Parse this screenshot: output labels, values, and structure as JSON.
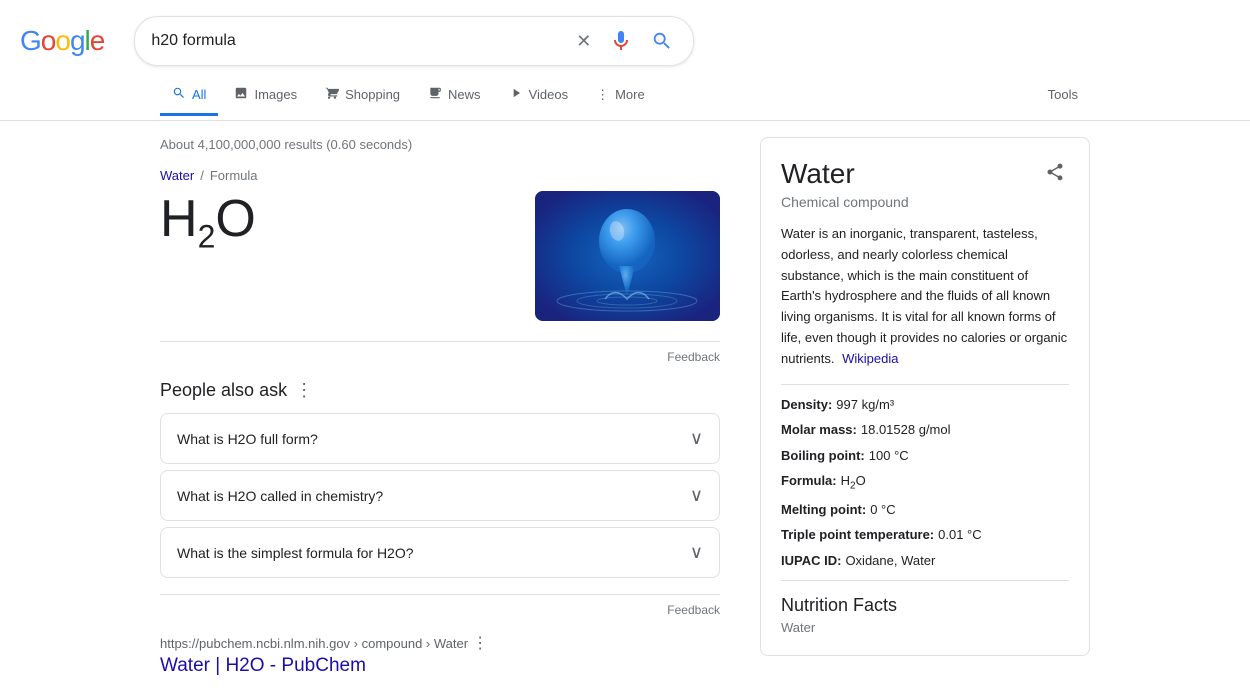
{
  "header": {
    "logo_letters": [
      "G",
      "o",
      "o",
      "g",
      "l",
      "e"
    ],
    "search_value": "h20 formula",
    "clear_label": "×",
    "mic_label": "mic",
    "search_label": "search"
  },
  "nav": {
    "tabs": [
      {
        "id": "all",
        "label": "All",
        "icon": "🔍",
        "active": true
      },
      {
        "id": "images",
        "label": "Images",
        "icon": "🖼"
      },
      {
        "id": "shopping",
        "label": "Shopping",
        "icon": "🏷"
      },
      {
        "id": "news",
        "label": "News",
        "icon": "📰"
      },
      {
        "id": "videos",
        "label": "Videos",
        "icon": "▶"
      },
      {
        "id": "more",
        "label": "More",
        "icon": "⋮"
      }
    ],
    "tools_label": "Tools"
  },
  "results": {
    "count_text": "About 4,100,000,000 results (0.60 seconds)",
    "breadcrumb": {
      "parent": "Water",
      "sep": "/",
      "current": "Formula"
    },
    "formula_display": "H₂O",
    "feedback_label": "Feedback",
    "paa": {
      "title": "People also ask",
      "questions": [
        "What is H2O full form?",
        "What is H2O called in chemistry?",
        "What is the simplest formula for H2O?"
      ]
    },
    "feedback_label2": "Feedback",
    "search_result": {
      "url": "https://pubchem.ncbi.nlm.nih.gov › compound › Water",
      "title": "Water | H2O - PubChem"
    }
  },
  "knowledge_panel": {
    "title": "Water",
    "subtitle": "Chemical compound",
    "description": "Water is an inorganic, transparent, tasteless, odorless, and nearly colorless chemical substance, which is the main constituent of Earth's hydrosphere and the fluids of all known living organisms. It is vital for all known forms of life, even though it provides no calories or organic nutrients.",
    "wikipedia_label": "Wikipedia",
    "facts": [
      {
        "label": "Density:",
        "value": "997 kg/m³"
      },
      {
        "label": "Molar mass:",
        "value": "18.01528 g/mol"
      },
      {
        "label": "Boiling point:",
        "value": "100 °C"
      },
      {
        "label": "Formula:",
        "value": "H₂O"
      },
      {
        "label": "Melting point:",
        "value": "0 °C"
      },
      {
        "label": "Triple point temperature:",
        "value": "0.01 °C"
      },
      {
        "label": "IUPAC ID:",
        "value": "Oxidane, Water"
      }
    ],
    "nutrition_title": "Nutrition Facts",
    "nutrition_sub": "Water"
  }
}
